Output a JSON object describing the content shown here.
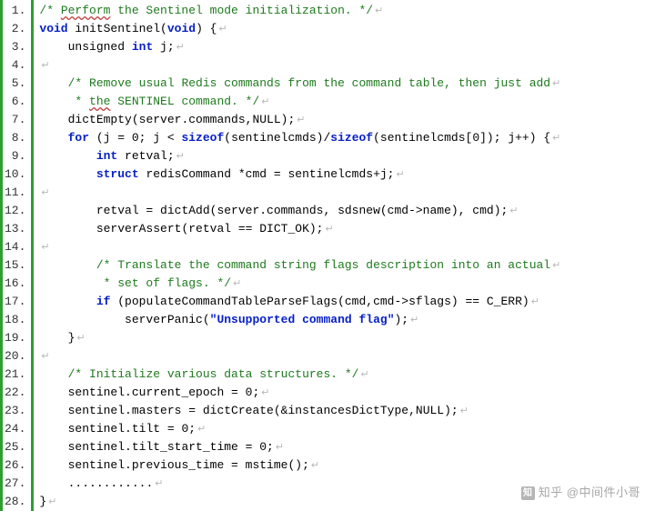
{
  "watermark": "知乎 @中间件小哥",
  "code": {
    "language": "c",
    "eol_glyph": "↵",
    "line_count": 28,
    "lines": [
      {
        "n": 1,
        "indent": 0,
        "tokens": [
          {
            "t": "c",
            "v": "/* "
          },
          {
            "t": "c squiggle",
            "v": "Perform"
          },
          {
            "t": "c",
            "v": " the Sentinel mode initialization. */"
          }
        ]
      },
      {
        "n": 2,
        "indent": 0,
        "tokens": [
          {
            "t": "kw",
            "v": "void"
          },
          {
            "t": "nr",
            "v": " initSentinel("
          },
          {
            "t": "kw",
            "v": "void"
          },
          {
            "t": "nr",
            "v": ") {"
          }
        ]
      },
      {
        "n": 3,
        "indent": 4,
        "tokens": [
          {
            "t": "nr",
            "v": "unsigned "
          },
          {
            "t": "kw",
            "v": "int"
          },
          {
            "t": "nr",
            "v": " j;"
          }
        ]
      },
      {
        "n": 4,
        "indent": 0,
        "tokens": []
      },
      {
        "n": 5,
        "indent": 4,
        "tokens": [
          {
            "t": "c",
            "v": "/* Remove usual Redis commands from the command table, then just add"
          }
        ]
      },
      {
        "n": 6,
        "indent": 4,
        "tokens": [
          {
            "t": "c",
            "v": " * "
          },
          {
            "t": "c squiggle",
            "v": "the"
          },
          {
            "t": "c",
            "v": " SENTINEL command. */"
          }
        ]
      },
      {
        "n": 7,
        "indent": 4,
        "tokens": [
          {
            "t": "nr",
            "v": "dictEmpty(server.commands,NULL);"
          }
        ]
      },
      {
        "n": 8,
        "indent": 4,
        "tokens": [
          {
            "t": "kw",
            "v": "for"
          },
          {
            "t": "nr",
            "v": " (j = 0; j < "
          },
          {
            "t": "kw",
            "v": "sizeof"
          },
          {
            "t": "nr",
            "v": "(sentinelcmds)/"
          },
          {
            "t": "kw",
            "v": "sizeof"
          },
          {
            "t": "nr",
            "v": "(sentinelcmds[0]); j++) {"
          }
        ]
      },
      {
        "n": 9,
        "indent": 8,
        "tokens": [
          {
            "t": "kw",
            "v": "int"
          },
          {
            "t": "nr",
            "v": " retval;"
          }
        ]
      },
      {
        "n": 10,
        "indent": 8,
        "tokens": [
          {
            "t": "kw",
            "v": "struct"
          },
          {
            "t": "nr",
            "v": " redisCommand *cmd = sentinelcmds+j;"
          }
        ]
      },
      {
        "n": 11,
        "indent": 0,
        "tokens": []
      },
      {
        "n": 12,
        "indent": 8,
        "tokens": [
          {
            "t": "nr",
            "v": "retval = dictAdd(server.commands, sdsnew(cmd->name), cmd);"
          }
        ]
      },
      {
        "n": 13,
        "indent": 8,
        "tokens": [
          {
            "t": "nr",
            "v": "serverAssert(retval == DICT_OK);"
          }
        ]
      },
      {
        "n": 14,
        "indent": 0,
        "tokens": []
      },
      {
        "n": 15,
        "indent": 8,
        "tokens": [
          {
            "t": "c",
            "v": "/* Translate the command string flags description into an actual"
          }
        ]
      },
      {
        "n": 16,
        "indent": 8,
        "tokens": [
          {
            "t": "c",
            "v": " * set of flags. */"
          }
        ]
      },
      {
        "n": 17,
        "indent": 8,
        "tokens": [
          {
            "t": "kw",
            "v": "if"
          },
          {
            "t": "nr",
            "v": " (populateCommandTableParseFlags(cmd,cmd->sflags) == C_ERR)"
          }
        ]
      },
      {
        "n": 18,
        "indent": 12,
        "tokens": [
          {
            "t": "nr",
            "v": "serverPanic("
          },
          {
            "t": "str",
            "v": "\"Unsupported command flag\""
          },
          {
            "t": "nr",
            "v": ");"
          }
        ]
      },
      {
        "n": 19,
        "indent": 4,
        "tokens": [
          {
            "t": "nr",
            "v": "}"
          }
        ]
      },
      {
        "n": 20,
        "indent": 0,
        "tokens": []
      },
      {
        "n": 21,
        "indent": 4,
        "tokens": [
          {
            "t": "c",
            "v": "/* Initialize various data structures. */"
          }
        ]
      },
      {
        "n": 22,
        "indent": 4,
        "tokens": [
          {
            "t": "nr",
            "v": "sentinel.current_epoch = 0;"
          }
        ]
      },
      {
        "n": 23,
        "indent": 4,
        "tokens": [
          {
            "t": "nr",
            "v": "sentinel.masters = dictCreate(&instancesDictType,NULL);"
          }
        ]
      },
      {
        "n": 24,
        "indent": 4,
        "tokens": [
          {
            "t": "nr",
            "v": "sentinel.tilt = 0;"
          }
        ]
      },
      {
        "n": 25,
        "indent": 4,
        "tokens": [
          {
            "t": "nr",
            "v": "sentinel.tilt_start_time = 0;"
          }
        ]
      },
      {
        "n": 26,
        "indent": 4,
        "tokens": [
          {
            "t": "nr",
            "v": "sentinel.previous_time = mstime();"
          }
        ]
      },
      {
        "n": 27,
        "indent": 4,
        "tokens": [
          {
            "t": "nr",
            "v": "............"
          }
        ]
      },
      {
        "n": 28,
        "indent": 0,
        "tokens": [
          {
            "t": "nr",
            "v": "}"
          }
        ]
      }
    ]
  }
}
